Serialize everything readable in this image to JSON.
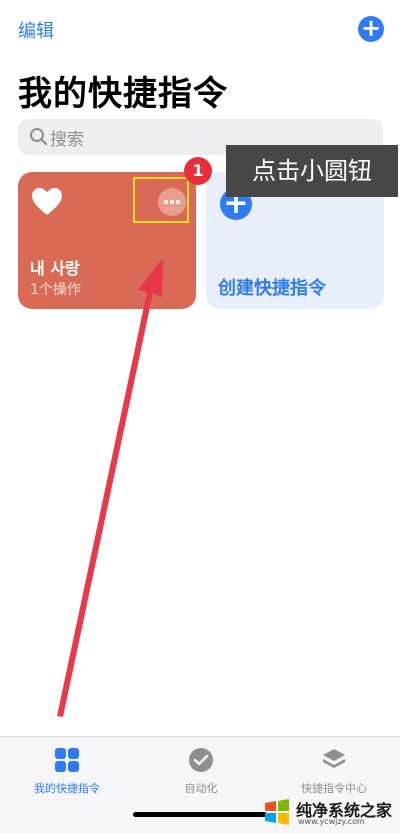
{
  "header": {
    "edit_label": "编辑",
    "add_symbol": "+",
    "title": "我的快捷指令"
  },
  "search": {
    "placeholder": "搜索"
  },
  "shortcuts": [
    {
      "title": "내 사랑",
      "subtitle": "1个操作",
      "color": "#d96a55",
      "icon": "heart-icon"
    }
  ],
  "create_card": {
    "label": "创建快捷指令",
    "plus": "+"
  },
  "annotation": {
    "badge_number": "1",
    "tooltip_text": "点击小圆钮"
  },
  "tab_bar": {
    "tabs": [
      {
        "label": "我的快捷指令",
        "icon": "grid-icon",
        "active": true
      },
      {
        "label": "自动化",
        "icon": "automation-check-icon",
        "active": false
      },
      {
        "label": "快捷指令中心",
        "icon": "layers-icon",
        "active": false
      }
    ]
  },
  "watermark": {
    "name": "纯净系统之家",
    "url": "www.ycwjzy.com"
  },
  "colors": {
    "accent": "#2f7bf5",
    "card_red": "#d96a55",
    "card_blue": "#e8eefa",
    "badge_red": "#e5303a",
    "highlight_yellow": "#f5e11c"
  }
}
